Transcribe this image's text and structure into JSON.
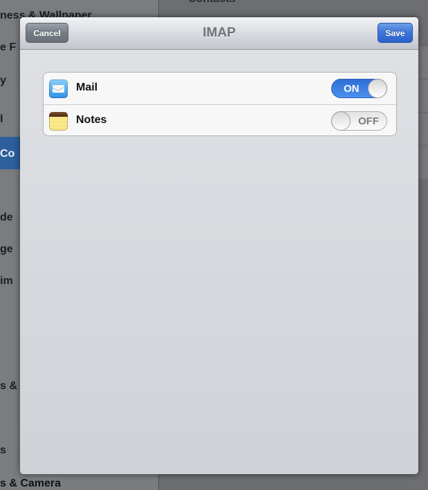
{
  "background": {
    "left_items": [
      {
        "label": "ness & Wallpaper"
      },
      {
        "label": "e F"
      },
      {
        "label": "y"
      },
      {
        "label": "l"
      },
      {
        "label": "Co"
      },
      {
        "label": ""
      },
      {
        "label": "de"
      },
      {
        "label": "ge"
      },
      {
        "label": "im"
      },
      {
        "label": ""
      },
      {
        "label": ""
      },
      {
        "label": "s &"
      },
      {
        "label": ""
      },
      {
        "label": "s"
      }
    ],
    "bottom_label": "s & Camera",
    "right_header": "Contacts"
  },
  "modal": {
    "title": "IMAP",
    "cancel_label": "Cancel",
    "save_label": "Save",
    "rows": [
      {
        "icon": "mail-icon",
        "label": "Mail",
        "toggle_text": "ON",
        "state": "on"
      },
      {
        "icon": "notes-icon",
        "label": "Notes",
        "toggle_text": "OFF",
        "state": "off"
      }
    ]
  },
  "colors": {
    "save_blue": "#3c74d8",
    "toggle_on_blue": "#2e6fd4",
    "selected_row_blue": "#2d5f9c"
  }
}
